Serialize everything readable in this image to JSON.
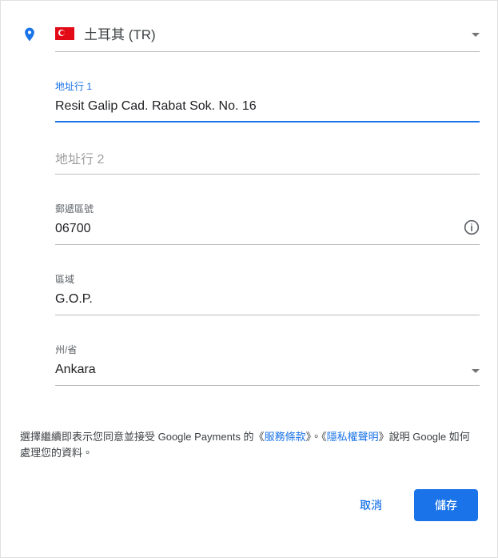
{
  "country": {
    "label": "土耳其 (TR)"
  },
  "fields": {
    "address1": {
      "label": "地址行 1",
      "value": "Resit Galip Cad. Rabat Sok. No. 16"
    },
    "address2": {
      "placeholder": "地址行 2"
    },
    "postal": {
      "label": "郵遞區號",
      "value": "06700"
    },
    "district": {
      "label": "區域",
      "value": "G.O.P."
    },
    "province": {
      "label": "州/省",
      "value": "Ankara"
    }
  },
  "consent": {
    "part1": "選擇繼續即表示您同意並接受 Google Payments 的《",
    "tos": "服務條款",
    "part2": "》。《",
    "privacy": "隱私權聲明",
    "part3": "》說明 Google 如何處理您的資料。"
  },
  "buttons": {
    "cancel": "取消",
    "save": "儲存"
  }
}
